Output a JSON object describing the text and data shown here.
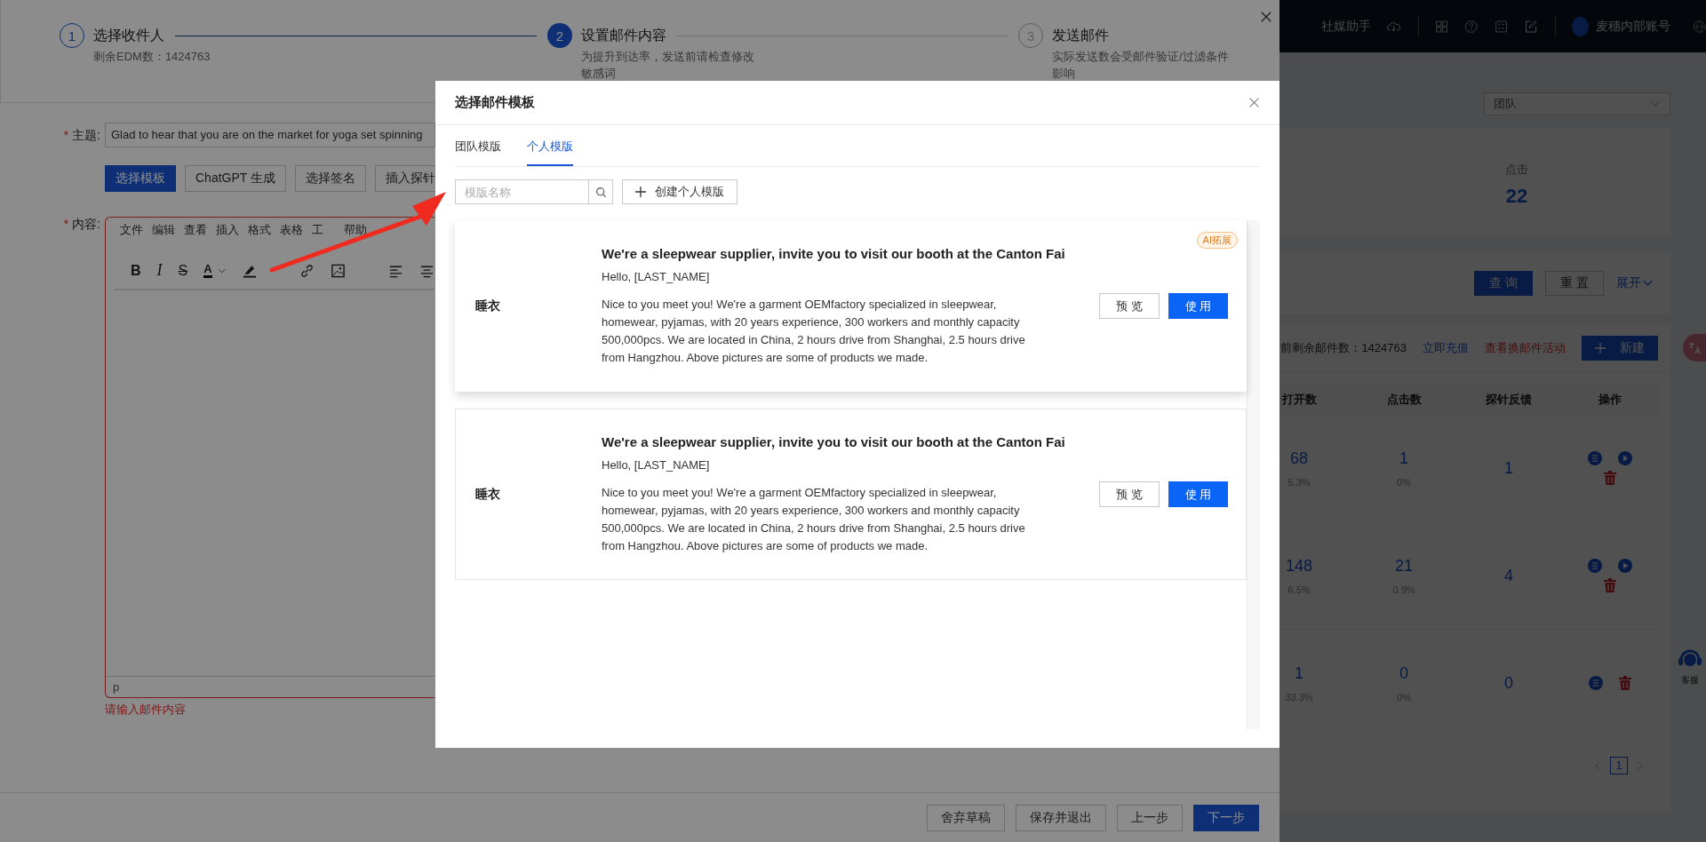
{
  "drawer": {
    "steps": [
      {
        "number": "1",
        "title": "选择收件人",
        "description": "剩余EDM数：1424763",
        "finished": true,
        "current": false
      },
      {
        "number": "2",
        "title": "设置邮件内容",
        "description": "为提升到达率，发送前请检查修改敏感词",
        "finished": false,
        "current": true
      },
      {
        "number": "3",
        "title": "发送邮件",
        "description": "实际发送数会受邮件验证/过滤条件影响",
        "finished": false,
        "current": false
      }
    ],
    "subject": {
      "label": "主题:",
      "required_mark": "*",
      "value": "Glad to hear that you are on the market for yoga set spinning"
    },
    "tool_buttons": [
      {
        "label": "选择模板",
        "primary": true
      },
      {
        "label": "ChatGPT 生成",
        "primary": false
      },
      {
        "label": "选择签名",
        "primary": false
      },
      {
        "label": "插入探针",
        "primary": false
      }
    ],
    "content": {
      "label": "内容:",
      "required_mark": "*",
      "menu": [
        "文件",
        "编辑",
        "查看",
        "插入",
        "格式",
        "表格",
        "工",
        "帮助"
      ],
      "format_tools": [
        {
          "kind": "bold",
          "label": "B"
        },
        {
          "kind": "italic",
          "label": "I"
        },
        {
          "kind": "strike",
          "label": "S"
        },
        {
          "kind": "color",
          "label": "A"
        },
        {
          "kind": "highlight"
        },
        {
          "kind": "link"
        },
        {
          "kind": "image"
        },
        {
          "kind": "align-left"
        },
        {
          "kind": "align-center"
        }
      ],
      "path": "p",
      "error": "请输入邮件内容"
    },
    "footer_buttons": [
      {
        "label": "舍弃草稿",
        "primary": false
      },
      {
        "label": "保存并退出",
        "primary": false
      },
      {
        "label": "上一步",
        "primary": false
      },
      {
        "label": "下一步",
        "primary": true
      }
    ]
  },
  "app": {
    "topbar": {
      "assistant": "社媒助手",
      "account": "麦穗内部账号"
    },
    "team_select": {
      "value": "团队"
    },
    "stats": [
      {
        "label": "点击",
        "value": "22"
      }
    ],
    "filter_buttons": [
      {
        "label": "查 询",
        "primary": true
      },
      {
        "label": "重 置",
        "primary": false
      }
    ],
    "expand": "展开",
    "quota": {
      "text": "前剩余邮件数：1424763",
      "recharge": "立即充值",
      "activity": "查看换邮件活动",
      "new_button": "新建"
    },
    "table": {
      "columns": [
        "打开数",
        "点击数",
        "探针反馈",
        "操作"
      ],
      "rows": [
        {
          "opens": "68",
          "open_rate": "5.3%",
          "clicks": "1",
          "click_rate": "0%",
          "probe": "1",
          "playable": true
        },
        {
          "opens": "148",
          "open_rate": "6.5%",
          "clicks": "21",
          "click_rate": "0.9%",
          "probe": "4",
          "playable": true
        },
        {
          "opens": "1",
          "open_rate": "33.3%",
          "clicks": "0",
          "click_rate": "0%",
          "probe": "0",
          "playable": false
        }
      ]
    },
    "pagination": [
      {
        "label": "1",
        "selected": true
      }
    ],
    "service": "客服"
  },
  "modal": {
    "title": "选择邮件模板",
    "tabs": [
      {
        "label": "团队模版",
        "selected": false
      },
      {
        "label": "个人模版",
        "selected": true
      }
    ],
    "search": {
      "placeholder": "模版名称"
    },
    "create_button": "创建个人模版",
    "templates": [
      {
        "category": "睡衣",
        "title": "We're a sleepwear supplier, invite you to visit our booth at the Canton Fai",
        "greeting": "Hello, [LAST_NAME]",
        "body": "Nice to you meet you! We're a garment OEMfactory specialized in sleepwear, homewear, pyjamas, with 20 years experience, 300 workers and monthly capacity 500,000pcs. We are located in China, 2 hours drive from Shanghai, 2.5 hours drive from Hangzhou. Above pictures are some of products we made.",
        "badge": "AI拓展",
        "hovered": true,
        "preview": "预 览",
        "use": "使 用"
      },
      {
        "category": "睡衣",
        "title": "We're a sleepwear supplier, invite you to visit our booth at the Canton Fai",
        "greeting": "Hello, [LAST_NAME]",
        "body": "Nice to you meet you! We're a garment OEMfactory specialized in sleepwear, homewear, pyjamas, with 20 years experience, 300 workers and monthly capacity 500,000pcs. We are located in China, 2 hours drive from Shanghai, 2.5 hours drive from Hangzhou. Above pictures are some of products we made.",
        "hovered": false,
        "preview": "预 览",
        "use": "使 用"
      }
    ]
  }
}
